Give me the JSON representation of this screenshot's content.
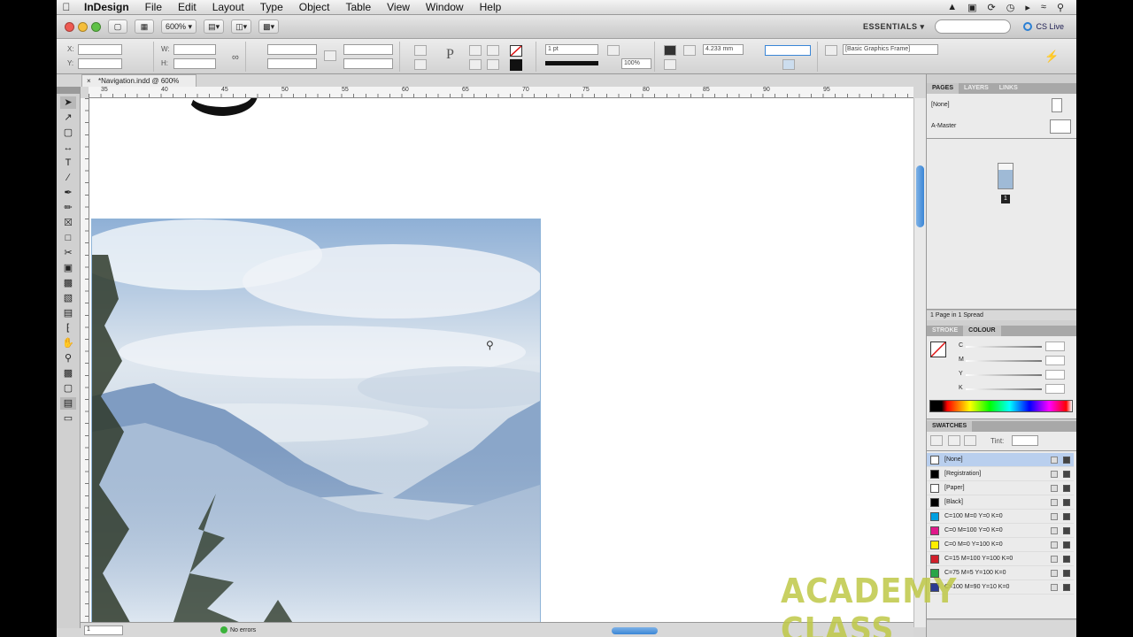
{
  "menubar": {
    "app_name": "InDesign",
    "items": [
      "File",
      "Edit",
      "Layout",
      "Type",
      "Object",
      "Table",
      "View",
      "Window",
      "Help"
    ]
  },
  "appbar": {
    "zoom": "600%",
    "workspace": "ESSENTIALS",
    "search_placeholder": "",
    "cs_live": "CS Live"
  },
  "control": {
    "x_label": "X:",
    "y_label": "Y:",
    "w_label": "W:",
    "h_label": "H:",
    "stroke_weight": "1 pt",
    "opacity": "100%",
    "size_value": "4.233 mm",
    "object_style": "[Basic Graphics Frame]"
  },
  "document": {
    "tab_title": "*Navigation.indd @ 600%",
    "ruler_numbers": [
      "35",
      "40",
      "45",
      "50",
      "55",
      "60",
      "65",
      "70",
      "75",
      "80",
      "85",
      "90",
      "95"
    ],
    "page_field": "1",
    "errors_label": "No errors"
  },
  "pages_panel": {
    "tabs": [
      "PAGES",
      "LAYERS",
      "LINKS"
    ],
    "masters": [
      "[None]",
      "A-Master"
    ],
    "page_number": "1",
    "footer": "1 Page in 1 Spread"
  },
  "colour_panel": {
    "tabs": [
      "STROKE",
      "COLOUR"
    ],
    "channels": [
      "C",
      "M",
      "Y",
      "K"
    ]
  },
  "swatches_panel": {
    "title": "SWATCHES",
    "tint_label": "Tint:",
    "items": [
      {
        "name": "[None]",
        "color": "#ffffff",
        "selected": true
      },
      {
        "name": "[Registration]",
        "color": "#000000"
      },
      {
        "name": "[Paper]",
        "color": "#ffffff"
      },
      {
        "name": "[Black]",
        "color": "#000000"
      },
      {
        "name": "C=100 M=0 Y=0 K=0",
        "color": "#00a0e0"
      },
      {
        "name": "C=0 M=100 Y=0 K=0",
        "color": "#e0188a"
      },
      {
        "name": "C=0 M=0 Y=100 K=0",
        "color": "#ffee00"
      },
      {
        "name": "C=15 M=100 Y=100 K=0",
        "color": "#d01f2a"
      },
      {
        "name": "C=75 M=5 Y=100 K=0",
        "color": "#2aa548"
      },
      {
        "name": "C=100 M=90 Y=10 K=0",
        "color": "#2c3b92"
      }
    ]
  },
  "watermark": "ACADEMY CLASS",
  "colors": {
    "accent": "#3a86d6",
    "sky": "#9fbad6",
    "watermark": "#bec846"
  }
}
